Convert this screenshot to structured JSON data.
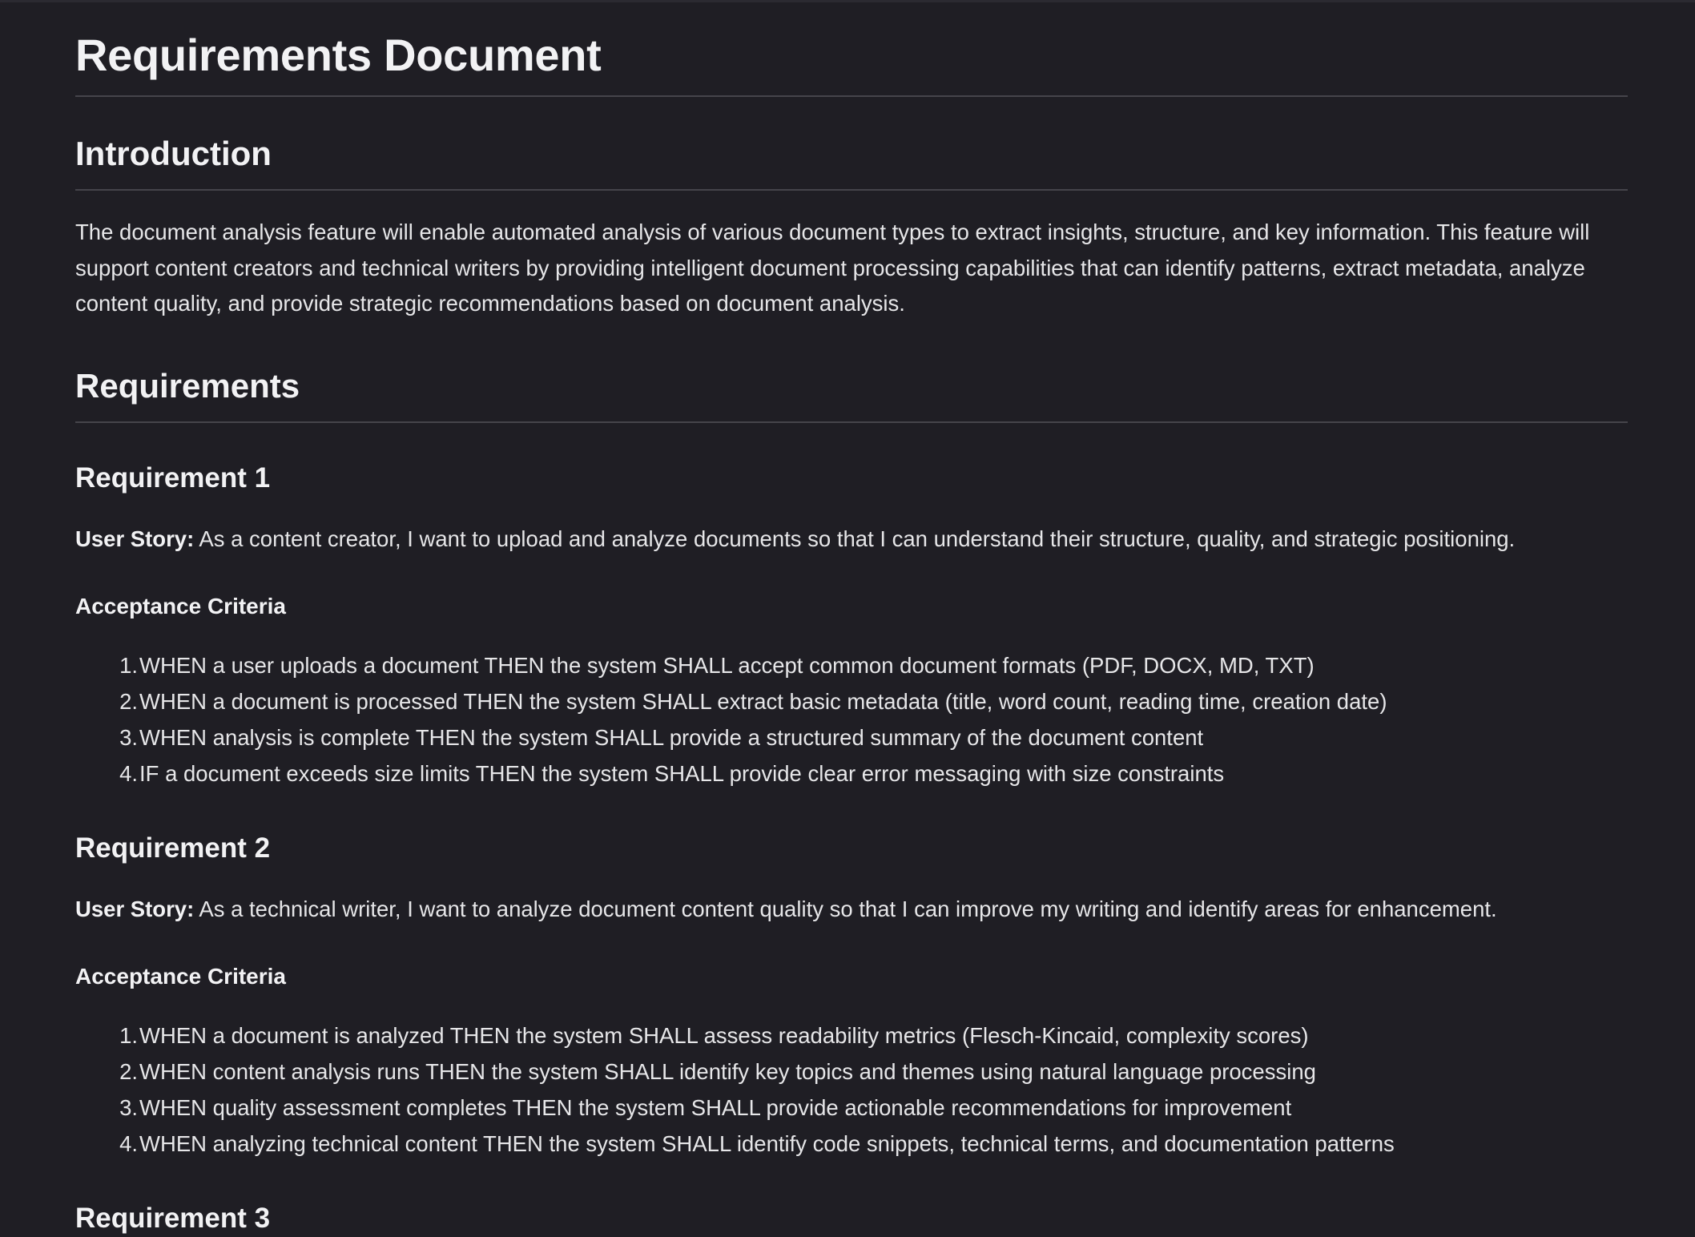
{
  "document": {
    "title": "Requirements Document",
    "introduction": {
      "heading": "Introduction",
      "text": "The document analysis feature will enable automated analysis of various document types to extract insights, structure, and key information. This feature will support content creators and technical writers by providing intelligent document processing capabilities that can identify patterns, extract metadata, analyze content quality, and provide strategic recommendations based on document analysis."
    },
    "requirements_heading": "Requirements",
    "requirements": [
      {
        "heading": "Requirement 1",
        "story_label": "User Story:",
        "story_text": " As a content creator, I want to upload and analyze documents so that I can understand their structure, quality, and strategic positioning.",
        "criteria_heading": "Acceptance Criteria",
        "criteria": [
          {
            "num": "1.",
            "text": "WHEN a user uploads a document THEN the system SHALL accept common document formats (PDF, DOCX, MD, TXT)"
          },
          {
            "num": "2.",
            "text": "WHEN a document is processed THEN the system SHALL extract basic metadata (title, word count, reading time, creation date)"
          },
          {
            "num": "3.",
            "text": "WHEN analysis is complete THEN the system SHALL provide a structured summary of the document content"
          },
          {
            "num": "4.",
            "text": "IF a document exceeds size limits THEN the system SHALL provide clear error messaging with size constraints"
          }
        ]
      },
      {
        "heading": "Requirement 2",
        "story_label": "User Story:",
        "story_text": " As a technical writer, I want to analyze document content quality so that I can improve my writing and identify areas for enhancement.",
        "criteria_heading": "Acceptance Criteria",
        "criteria": [
          {
            "num": "1.",
            "text": "WHEN a document is analyzed THEN the system SHALL assess readability metrics (Flesch-Kincaid, complexity scores)"
          },
          {
            "num": "2.",
            "text": "WHEN content analysis runs THEN the system SHALL identify key topics and themes using natural language processing"
          },
          {
            "num": "3.",
            "text": "WHEN quality assessment completes THEN the system SHALL provide actionable recommendations for improvement"
          },
          {
            "num": "4.",
            "text": "WHEN analyzing technical content THEN the system SHALL identify code snippets, technical terms, and documentation patterns"
          }
        ]
      },
      {
        "heading": "Requirement 3"
      }
    ]
  }
}
